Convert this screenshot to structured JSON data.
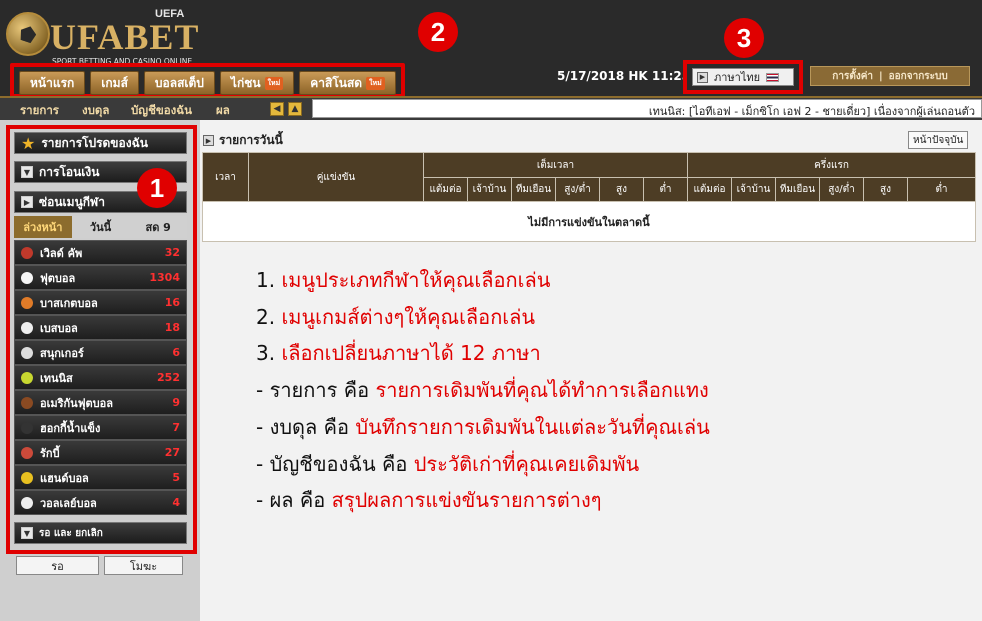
{
  "brand": {
    "name": "UFABET",
    "badge": "UEFA",
    "tagline": "SPORT BETTING AND CASINO ONLINE"
  },
  "main_tabs": [
    {
      "label": "หน้าแรก"
    },
    {
      "label": "เกมส์"
    },
    {
      "label": "บอลสเต็ป"
    },
    {
      "label": "ไก่ชน",
      "badge": "ใหม่"
    },
    {
      "label": "คาสิโนสด",
      "badge": "ใหม่"
    }
  ],
  "markers": [
    "1",
    "2",
    "3"
  ],
  "header": {
    "datetime": "5/17/2018 HK 11:25 AM",
    "language": "ภาษาไทย",
    "settings": "การตั้งค่า",
    "logout": "ออกจากระบบ",
    "separator": "|"
  },
  "subnav": {
    "links": [
      "รายการ",
      "งบดุล",
      "บัญชีของฉัน",
      "ผล"
    ],
    "ticker": "เทนนิส: [ไอทีเอฟ - เม็กซิโก เอฟ 2 - ชายเดี่ยว] เนื่องจากผู้เล่นถอนตัว"
  },
  "sidebar": {
    "favorites": "รายการโปรดของฉัน",
    "transfer": "การโอนเงิน",
    "hide_menu": "ซ่อนเมนูกีฬา",
    "tabs": [
      "ล่วงหน้า",
      "วันนี้",
      "สด 9"
    ],
    "sports": [
      {
        "label": "เวิลด์ คัพ",
        "count": "32",
        "color": "#c0392b"
      },
      {
        "label": "ฟุตบอล",
        "count": "1304",
        "color": "#f5f5f5"
      },
      {
        "label": "บาสเกตบอล",
        "count": "16",
        "color": "#e07b28"
      },
      {
        "label": "เบสบอล",
        "count": "18",
        "color": "#eeeeee"
      },
      {
        "label": "สนุกเกอร์",
        "count": "6",
        "color": "#dddddd"
      },
      {
        "label": "เทนนิส",
        "count": "252",
        "color": "#c8d830"
      },
      {
        "label": "อเมริกันฟุตบอล",
        "count": "9",
        "color": "#8a4a22"
      },
      {
        "label": "ฮอกกี้น้ำแข็ง",
        "count": "7",
        "color": "#333333"
      },
      {
        "label": "รักบี้",
        "count": "27",
        "color": "#cc4a3a"
      },
      {
        "label": "แฮนด์บอล",
        "count": "5",
        "color": "#e8c020"
      },
      {
        "label": "วอลเลย์บอล",
        "count": "4",
        "color": "#eeeeee"
      }
    ],
    "bottom": "รอ และ ยกเลิก",
    "wait_btn": "รอ",
    "void_btn": "โมฆะ"
  },
  "main": {
    "today_label": "รายการวันนี้",
    "now_btn": "หน้าปัจจุบัน",
    "table": {
      "time": "เวลา",
      "match": "คู่แข่งขัน",
      "full_time": "เต็มเวลา",
      "first_half": "ครึ่งแรก",
      "sub_cols": [
        "แต้มต่อ",
        "เจ้าบ้าน",
        "ทีมเยือน",
        "สูง/ต่ำ",
        "สูง",
        "ต่ำ"
      ],
      "empty": "ไม่มีการแข่งขันในตลาดนี้"
    }
  },
  "notes": [
    {
      "key": "1. ",
      "value": "เมนูประเภทกีฬาให้คุณเลือกเล่น"
    },
    {
      "key": "2. ",
      "value": "เมนูเกมส์ต่างๆให้คุณเลือกเล่น"
    },
    {
      "key": "3. ",
      "value": "เลือกเปลี่ยนภาษาได้ 12 ภาษา"
    },
    {
      "key": "- รายการ คือ ",
      "value": "รายการเดิมพันที่คุณได้ทำการเลือกแทง"
    },
    {
      "key": "- งบดุล คือ ",
      "value": "บันทึกรายการเดิมพันในแต่ละวันที่คุณเล่น"
    },
    {
      "key": "- บัญชีของฉัน คือ ",
      "value": "ประวัติเก่าที่คุณเคยเดิมพัน"
    },
    {
      "key": "- ผล คือ ",
      "value": "สรุปผลการแข่งขันรายการต่างๆ"
    }
  ]
}
